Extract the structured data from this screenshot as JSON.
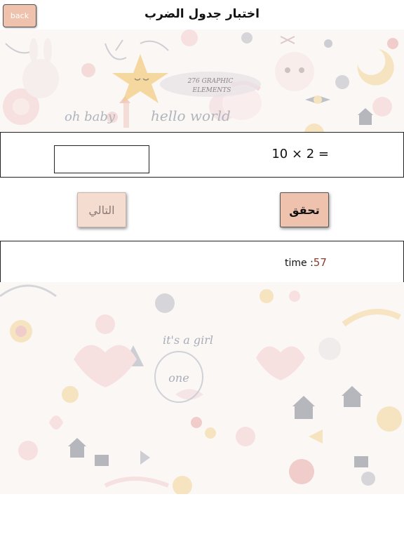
{
  "header": {
    "back_label": "back",
    "title": "اختبار جدول الضرب"
  },
  "banner": {
    "graphic_count": "276 GRAPHIC",
    "graphic_elements": "ELEMENTS",
    "oh_baby": "oh baby",
    "hello_world": "hello world"
  },
  "question": {
    "text": "10 × 2 =",
    "answer_value": ""
  },
  "buttons": {
    "next_label": "التالي",
    "check_label": "تحقق"
  },
  "timer": {
    "label": "time :",
    "value": "57"
  },
  "pattern_bottom": {
    "its_a_girl": "it's a girl",
    "one": "one"
  },
  "colors": {
    "accent": "#efc2ad",
    "accent_light": "#f5dcd1",
    "timer_value": "#8b3a2e"
  }
}
